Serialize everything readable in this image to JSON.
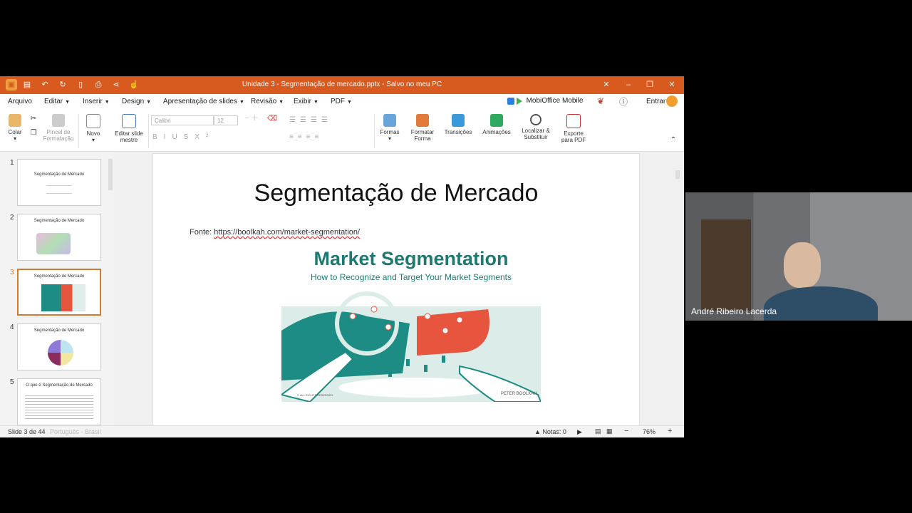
{
  "window": {
    "title": "Unidade 3 - Segmentação de mercado.pptx - Salvo no meu PC"
  },
  "menu": {
    "items": [
      "Arquivo",
      "Editar",
      "Inserir",
      "Design",
      "Apresentação de slides",
      "Revisão",
      "Exibir",
      "PDF"
    ],
    "mobioffice": "MobiOffice Mobile",
    "login": "Entrar"
  },
  "ribbon": {
    "paste": "Colar",
    "format_painter": "Pincel de Formatação",
    "new": "Novo",
    "edit_master": "Editar slide mestre",
    "font_name": "Calibri",
    "font_size": "12",
    "shapes": "Formas",
    "format_shape": "Formatar Forma",
    "transitions": "Transições",
    "animations": "Animações",
    "find_replace": "Localizar & Substituir",
    "export_pdf": "Exporte para PDF"
  },
  "slides_panel": [
    {
      "num": "1",
      "title": "Segmentação de Mercado"
    },
    {
      "num": "2",
      "title": "Segmentação de Mercado"
    },
    {
      "num": "3",
      "title": "Segmentação de Mercado"
    },
    {
      "num": "4",
      "title": "Segmentação de Mercado"
    },
    {
      "num": "5",
      "title": "O que é Segmentação de Mercado"
    }
  ],
  "slide": {
    "title": "Segmentação de Mercado",
    "source_label": "Fonte: ",
    "source_url": "https://boolkah.com/market-segmentation/",
    "image": {
      "heading": "Market Segmentation",
      "subheading": "How to Recognize and Target Your Market Segments",
      "credit": "PETER BOOLKAH",
      "copyright": "© ALL RIGHTS RESERVED"
    }
  },
  "status": {
    "slide_counter": "Slide 3 de 44",
    "language": "Português - Brasil",
    "notes": "Notas: 0",
    "zoom": "76%"
  },
  "video": {
    "participant_name": "André Ribeiro Lacerda"
  },
  "colors": {
    "accent": "#d85a1f",
    "teal": "#1d8c84",
    "coral": "#e8553f"
  }
}
